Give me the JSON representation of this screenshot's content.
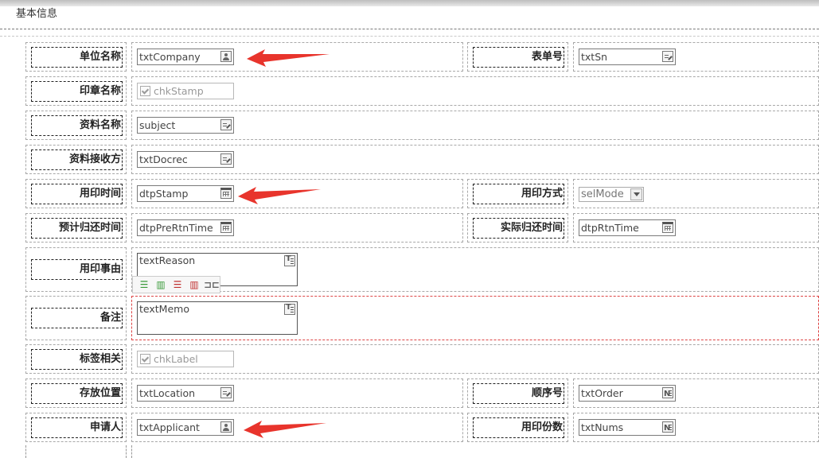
{
  "section": {
    "title": "基本信息"
  },
  "rows": {
    "company": {
      "label": "单位名称",
      "value": "txtCompany"
    },
    "sn": {
      "label": "表单号",
      "value": "txtSn"
    },
    "stamp_name": {
      "label": "印章名称",
      "value": "chkStamp"
    },
    "subject": {
      "label": "资料名称",
      "value": "subject"
    },
    "docrec": {
      "label": "资料接收方",
      "value": "txtDocrec"
    },
    "stamp_time": {
      "label": "用印时间",
      "value": "dtpStamp"
    },
    "mode": {
      "label": "用印方式",
      "value": "selMode"
    },
    "pre_return": {
      "label": "预计归还时间",
      "value": "dtpPreRtnTime"
    },
    "actual_return": {
      "label": "实际归还时间",
      "value": "dtpRtnTime"
    },
    "reason": {
      "label": "用印事由",
      "value": "textReason"
    },
    "memo": {
      "label": "备注",
      "value": "textMemo"
    },
    "label_rel": {
      "label": "标签相关",
      "value": "chkLabel"
    },
    "location": {
      "label": "存放位置",
      "value": "txtLocation"
    },
    "order": {
      "label": "顺序号",
      "value": "txtOrder"
    },
    "applicant": {
      "label": "申请人",
      "value": "txtApplicant"
    },
    "nums": {
      "label": "用印份数",
      "value": "txtNums"
    }
  },
  "toolbar": {
    "buttons": [
      "align-left-icon",
      "align-center-icon",
      "align-right-icon",
      "distribute-icon",
      "merge-icon"
    ],
    "merge_glyph": "⊐⊏"
  },
  "colors": {
    "annotation_arrow": "#e8342c",
    "selection_border": "#dd4444"
  },
  "icons": {
    "user": "user-picker-icon",
    "edit": "edit-icon",
    "calendar": "calendar-icon",
    "text": "textarea-icon",
    "number": "number-icon"
  }
}
